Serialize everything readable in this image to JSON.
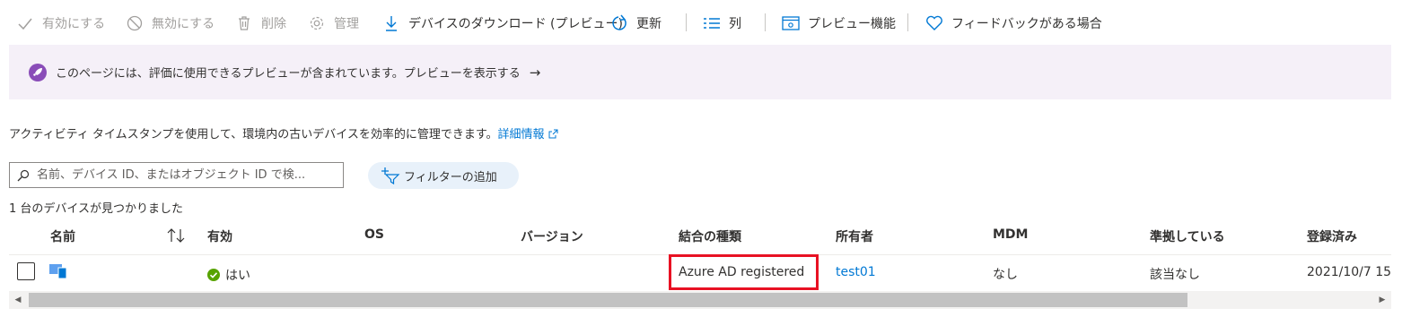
{
  "toolbar": {
    "enable": "有効にする",
    "disable": "無効にする",
    "delete": "削除",
    "manage": "管理",
    "download": "デバイスのダウンロード (プレビュー)",
    "refresh": "更新",
    "columns": "列",
    "preview_features": "プレビュー機能",
    "feedback": "フィードバックがある場合"
  },
  "banner": {
    "text": "このページには、評価に使用できるプレビューが含まれています。プレビューを表示する",
    "arrow": "→"
  },
  "description": {
    "text": "アクティビティ タイムスタンプを使用して、環境内の古いデバイスを効率的に管理できます。",
    "link": "詳細情報"
  },
  "search": {
    "placeholder": "名前、デバイス ID、またはオブジェクト ID で検..."
  },
  "filter": {
    "label": "フィルターの追加"
  },
  "result_count": "1 台のデバイスが見つかりました",
  "table": {
    "headers": {
      "name": "名前",
      "enabled": "有効",
      "os": "OS",
      "version": "バージョン",
      "join_type": "結合の種類",
      "owner": "所有者",
      "mdm": "MDM",
      "compliant": "準拠している",
      "registered": "登録済み"
    },
    "rows": [
      {
        "enabled": "はい",
        "join_type": "Azure AD registered",
        "owner": "test01",
        "mdm": "なし",
        "compliant": "該当なし",
        "registered": "2021/10/7 15"
      }
    ]
  },
  "colors": {
    "accent": "#0078d4",
    "banner_bg": "#f5f0f8",
    "rocket": "#8a4db8",
    "success": "#57a300",
    "highlight": "#e81123"
  }
}
